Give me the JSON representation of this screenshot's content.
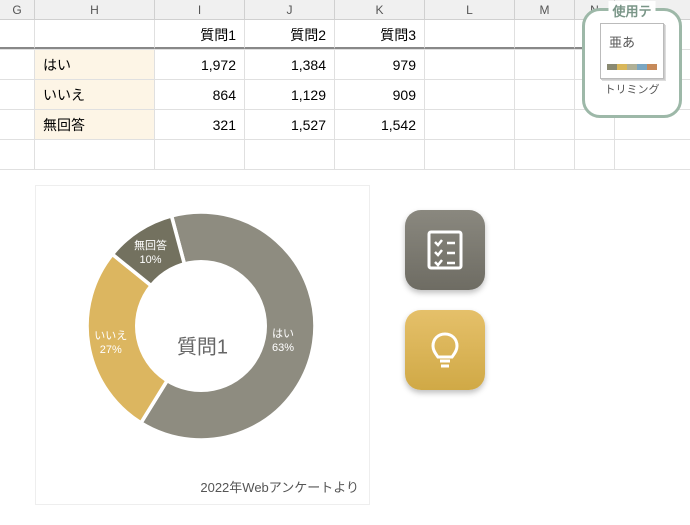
{
  "columns": [
    "G",
    "H",
    "I",
    "J",
    "K",
    "L",
    "M",
    "N"
  ],
  "table": {
    "headers": [
      "質問1",
      "質問2",
      "質問3"
    ],
    "rows": [
      {
        "label": "はい",
        "vals": [
          "1,972",
          "1,384",
          "979"
        ]
      },
      {
        "label": "いいえ",
        "vals": [
          "864",
          "1,129",
          "909"
        ]
      },
      {
        "label": "無回答",
        "vals": [
          "321",
          "1,527",
          "1,542"
        ]
      }
    ]
  },
  "chart_data": {
    "type": "pie",
    "title": "質問1",
    "caption": "2022年Webアンケートより",
    "series": [
      {
        "name": "はい",
        "value": 1972,
        "pct": 63,
        "color": "#8e8c80"
      },
      {
        "name": "いいえ",
        "value": 864,
        "pct": 27,
        "color": "#dcb660"
      },
      {
        "name": "無回答",
        "value": 321,
        "pct": 10,
        "color": "#73715f"
      }
    ]
  },
  "theme": {
    "title": "使用テーマ",
    "sample": "亜あ",
    "caption": "トリミング"
  }
}
